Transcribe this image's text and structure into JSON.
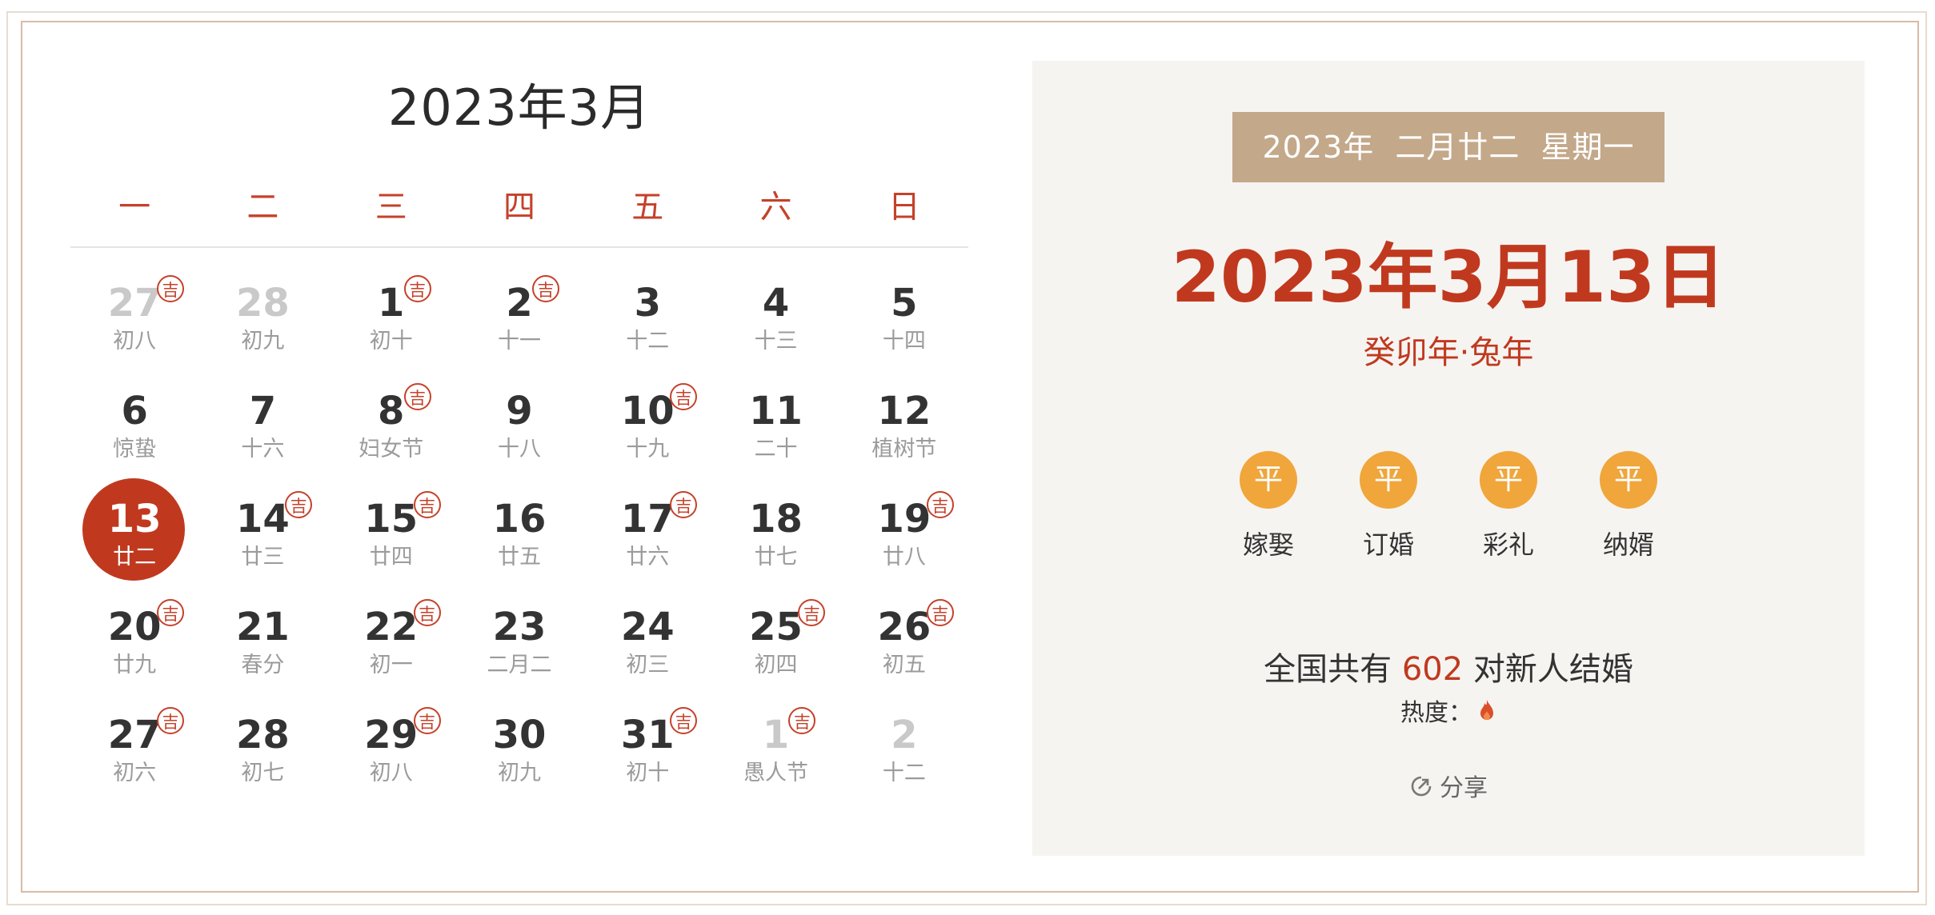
{
  "calendar": {
    "title": "2023年3月",
    "weekdays": [
      "一",
      "二",
      "三",
      "四",
      "五",
      "六",
      "日"
    ],
    "days": [
      {
        "num": "27",
        "lunar": "初八",
        "ji": true,
        "other": true
      },
      {
        "num": "28",
        "lunar": "初九",
        "ji": false,
        "other": true
      },
      {
        "num": "1",
        "lunar": "初十",
        "ji": true
      },
      {
        "num": "2",
        "lunar": "十一",
        "ji": true
      },
      {
        "num": "3",
        "lunar": "十二",
        "ji": false
      },
      {
        "num": "4",
        "lunar": "十三",
        "ji": false
      },
      {
        "num": "5",
        "lunar": "十四",
        "ji": false
      },
      {
        "num": "6",
        "lunar": "惊蛰",
        "ji": false
      },
      {
        "num": "7",
        "lunar": "十六",
        "ji": false
      },
      {
        "num": "8",
        "lunar": "妇女节",
        "ji": true
      },
      {
        "num": "9",
        "lunar": "十八",
        "ji": false
      },
      {
        "num": "10",
        "lunar": "十九",
        "ji": true
      },
      {
        "num": "11",
        "lunar": "二十",
        "ji": false
      },
      {
        "num": "12",
        "lunar": "植树节",
        "ji": false
      },
      {
        "num": "13",
        "lunar": "廿二",
        "ji": false,
        "selected": true
      },
      {
        "num": "14",
        "lunar": "廿三",
        "ji": true
      },
      {
        "num": "15",
        "lunar": "廿四",
        "ji": true
      },
      {
        "num": "16",
        "lunar": "廿五",
        "ji": false
      },
      {
        "num": "17",
        "lunar": "廿六",
        "ji": true
      },
      {
        "num": "18",
        "lunar": "廿七",
        "ji": false
      },
      {
        "num": "19",
        "lunar": "廿八",
        "ji": true
      },
      {
        "num": "20",
        "lunar": "廿九",
        "ji": true
      },
      {
        "num": "21",
        "lunar": "春分",
        "ji": false
      },
      {
        "num": "22",
        "lunar": "初一",
        "ji": true
      },
      {
        "num": "23",
        "lunar": "二月二",
        "ji": false
      },
      {
        "num": "24",
        "lunar": "初三",
        "ji": false
      },
      {
        "num": "25",
        "lunar": "初四",
        "ji": true
      },
      {
        "num": "26",
        "lunar": "初五",
        "ji": true
      },
      {
        "num": "27",
        "lunar": "初六",
        "ji": true
      },
      {
        "num": "28",
        "lunar": "初七",
        "ji": false
      },
      {
        "num": "29",
        "lunar": "初八",
        "ji": true
      },
      {
        "num": "30",
        "lunar": "初九",
        "ji": false
      },
      {
        "num": "31",
        "lunar": "初十",
        "ji": true
      },
      {
        "num": "1",
        "lunar": "愚人节",
        "ji": true,
        "other": true
      },
      {
        "num": "2",
        "lunar": "十二",
        "ji": false,
        "other": true
      }
    ],
    "ji_label": "吉"
  },
  "detail": {
    "lunar_banner": "2023年  二月廿二  星期一",
    "date": "2023年3月13日",
    "ganzhi": "癸卯年·兔年",
    "items": [
      {
        "badge": "平",
        "label": "嫁娶"
      },
      {
        "badge": "平",
        "label": "订婚"
      },
      {
        "badge": "平",
        "label": "彩礼"
      },
      {
        "badge": "平",
        "label": "纳婿"
      }
    ],
    "stat_prefix": "全国共有",
    "stat_count": "602",
    "stat_suffix": "对新人结婚",
    "heat_label": "热度：",
    "heat_icon": "flame-icon",
    "share_label": "分享",
    "share_icon": "share-icon"
  },
  "colors": {
    "accent": "#c0391f",
    "banner": "#c3a88a",
    "badge": "#f0a63a",
    "panel_bg": "#f6f4f1"
  }
}
